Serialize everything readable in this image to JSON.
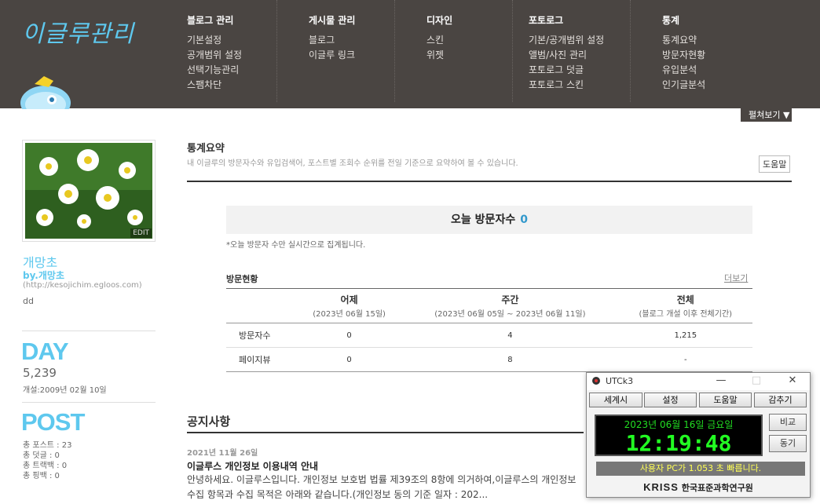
{
  "header": {
    "logo": "이글루관리",
    "columns": [
      {
        "title": "블로그 관리",
        "items": [
          "기본설정",
          "공개범위 설정",
          "선택기능관리",
          "스팸차단"
        ]
      },
      {
        "title": "게시물 관리",
        "items": [
          "블로그",
          "이글루 링크"
        ]
      },
      {
        "title": "디자인",
        "items": [
          "스킨",
          "위젯"
        ]
      },
      {
        "title": "포토로그",
        "items": [
          "기본/공개범위 설정",
          "앨범/사진 관리",
          "포토로그 덧글",
          "포토로그 스킨"
        ]
      },
      {
        "title": "통계",
        "items": [
          "통계요약",
          "방문자현황",
          "유입분석",
          "인기글분석"
        ]
      }
    ],
    "expand_label": "펼쳐보기"
  },
  "sidebar": {
    "edit": "EDIT",
    "blog_name": "개망초",
    "by": "by.개망초",
    "url": "(http://kesojichim.egloos.com)",
    "desc": "dd",
    "day_label": "DAY",
    "day_count": "5,239",
    "opened": "개설:2009년 02월 10일",
    "post_label": "POST",
    "post_stats": [
      "총 포스트 : 23",
      "총 덧글 : 0",
      "총 트랙백 : 0",
      "총 핑백 : 0"
    ]
  },
  "main": {
    "title": "통계요약",
    "subtitle": "내 이글루의 방문자수와 유입검색어, 포스트별 조회수 순위를 전일 기준으로 요약하여 볼 수 있습니다.",
    "help": "도움말",
    "today_label": "오늘 방문자수",
    "today_value": "0",
    "today_note": "*오늘 방문자 수만 실시간으로 집계됩니다.",
    "visit_title": "방문현황",
    "more": "더보기",
    "columns": [
      {
        "h": "어제",
        "s": "(2023년 06월 15일)"
      },
      {
        "h": "주간",
        "s": "(2023년 06월 05일 ~ 2023년 06월 11일)"
      },
      {
        "h": "전체",
        "s": "(블로그 개설 이후 전체기간)"
      }
    ],
    "rows": [
      {
        "label": "방문자수",
        "values": [
          "0",
          "4",
          "1,215"
        ]
      },
      {
        "label": "페이지뷰",
        "values": [
          "0",
          "8",
          "-"
        ]
      }
    ],
    "notice_title": "공지사항",
    "notice_date": "2021년 11월 26일",
    "notice_head": "이글루스 개인정보 이용내역 안내",
    "notice_body": "안녕하세요. 이글루스입니다. 개인정보 보호법 법률 제39조의 8항에 의거하여,이글루스의 개인정보 수집 항목과 수집 목적은 아래와 같습니다.(개인정보 동의 기준 일자 : 202..."
  },
  "utck": {
    "title": "UTCk3",
    "buttons": [
      "세계시",
      "설정",
      "도움말",
      "감추기"
    ],
    "date": "2023년 06월 16일 금요일",
    "time": "12:19:48",
    "compare": "비교",
    "sync": "동기",
    "message": "사용자 PC가 1.053 초 빠릅니다.",
    "kriss_logo": "KRISS",
    "kriss_name": "한국표준과학연구원"
  }
}
